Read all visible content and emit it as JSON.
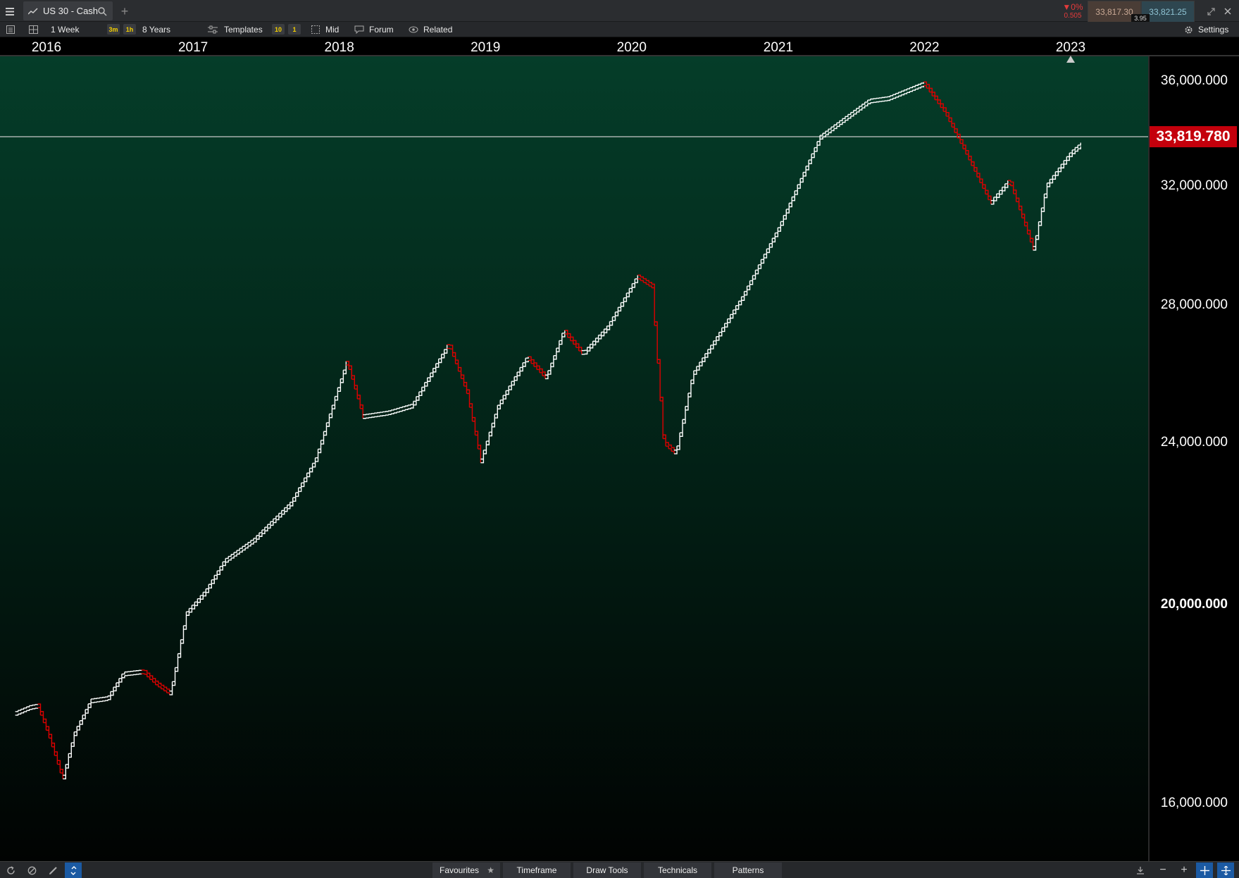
{
  "window": {
    "tab_title": "US 30 - Cash",
    "change_pct": "▼0%",
    "change_value": "0.505",
    "bid": "33,817.30",
    "ask": "33,821.25",
    "spread": "3.95"
  },
  "toolbar": {
    "period": "1 Week",
    "pill_3m": "3m",
    "pill_1h": "1h",
    "range": "8 Years",
    "templates": "Templates",
    "pill_10": "10",
    "pill_1": "1",
    "mid": "Mid",
    "forum": "Forum",
    "related": "Related",
    "settings": "Settings"
  },
  "bottom": {
    "favourites": "Favourites",
    "timeframe": "Timeframe",
    "draw_tools": "Draw Tools",
    "technicals": "Technicals",
    "patterns": "Patterns"
  },
  "colors": {
    "up": "#ffffff",
    "down": "#e00000",
    "accent": "#c4000c",
    "background_top": "#053d29"
  },
  "chart_data": {
    "type": "line",
    "title": "",
    "xlabel": "",
    "ylabel": "",
    "x_ticks": [
      "2016",
      "2017",
      "2018",
      "2019",
      "2020",
      "2021",
      "2022",
      "2023"
    ],
    "y_ticks": [
      "36,000.000",
      "32,000.000",
      "28,000.000",
      "24,000.000",
      "20,000.000",
      "16,000.000"
    ],
    "ylim": [
      15000,
      37000
    ],
    "y_scale": "log",
    "current_price_label": "33,819.780",
    "current_price": 33819.78,
    "series": [
      {
        "values": [
          [
            "2015-10-15",
            17700
          ],
          [
            "2015-11-20",
            17820
          ],
          [
            "2015-12-10",
            17850
          ],
          [
            "2016-01-05",
            17300
          ],
          [
            "2016-02-10",
            16450
          ],
          [
            "2016-03-10",
            17300
          ],
          [
            "2016-04-20",
            17950
          ],
          [
            "2016-06-01",
            18000
          ],
          [
            "2016-07-10",
            18500
          ],
          [
            "2016-08-30",
            18550
          ],
          [
            "2016-10-01",
            18300
          ],
          [
            "2016-11-05",
            18100
          ],
          [
            "2016-12-15",
            19800
          ],
          [
            "2017-02-01",
            20300
          ],
          [
            "2017-03-20",
            21000
          ],
          [
            "2017-06-01",
            21500
          ],
          [
            "2017-09-01",
            22400
          ],
          [
            "2017-11-01",
            23500
          ],
          [
            "2018-01-20",
            26300
          ],
          [
            "2018-03-01",
            24700
          ],
          [
            "2018-05-01",
            24800
          ],
          [
            "2018-07-01",
            25000
          ],
          [
            "2018-10-01",
            26800
          ],
          [
            "2018-11-15",
            25400
          ],
          [
            "2018-12-20",
            23500
          ],
          [
            "2019-02-01",
            25000
          ],
          [
            "2019-04-15",
            26400
          ],
          [
            "2019-06-01",
            25800
          ],
          [
            "2019-07-15",
            27200
          ],
          [
            "2019-09-01",
            26500
          ],
          [
            "2019-11-01",
            27300
          ],
          [
            "2020-01-15",
            28900
          ],
          [
            "2020-02-20",
            28600
          ],
          [
            "2020-03-20",
            24000
          ],
          [
            "2020-04-20",
            23700
          ],
          [
            "2020-06-01",
            25900
          ],
          [
            "2020-08-01",
            27000
          ],
          [
            "2020-10-01",
            28200
          ],
          [
            "2021-01-01",
            30500
          ],
          [
            "2021-04-15",
            33800
          ],
          [
            "2021-06-15",
            34500
          ],
          [
            "2021-08-15",
            35200
          ],
          [
            "2021-10-01",
            35300
          ],
          [
            "2022-01-01",
            35900
          ],
          [
            "2022-02-20",
            34800
          ],
          [
            "2022-04-15",
            33200
          ],
          [
            "2022-06-15",
            31400
          ],
          [
            "2022-08-01",
            32200
          ],
          [
            "2022-09-30",
            29800
          ],
          [
            "2022-11-01",
            32000
          ],
          [
            "2023-01-01",
            33200
          ],
          [
            "2023-02-01",
            33600
          ]
        ]
      }
    ]
  }
}
